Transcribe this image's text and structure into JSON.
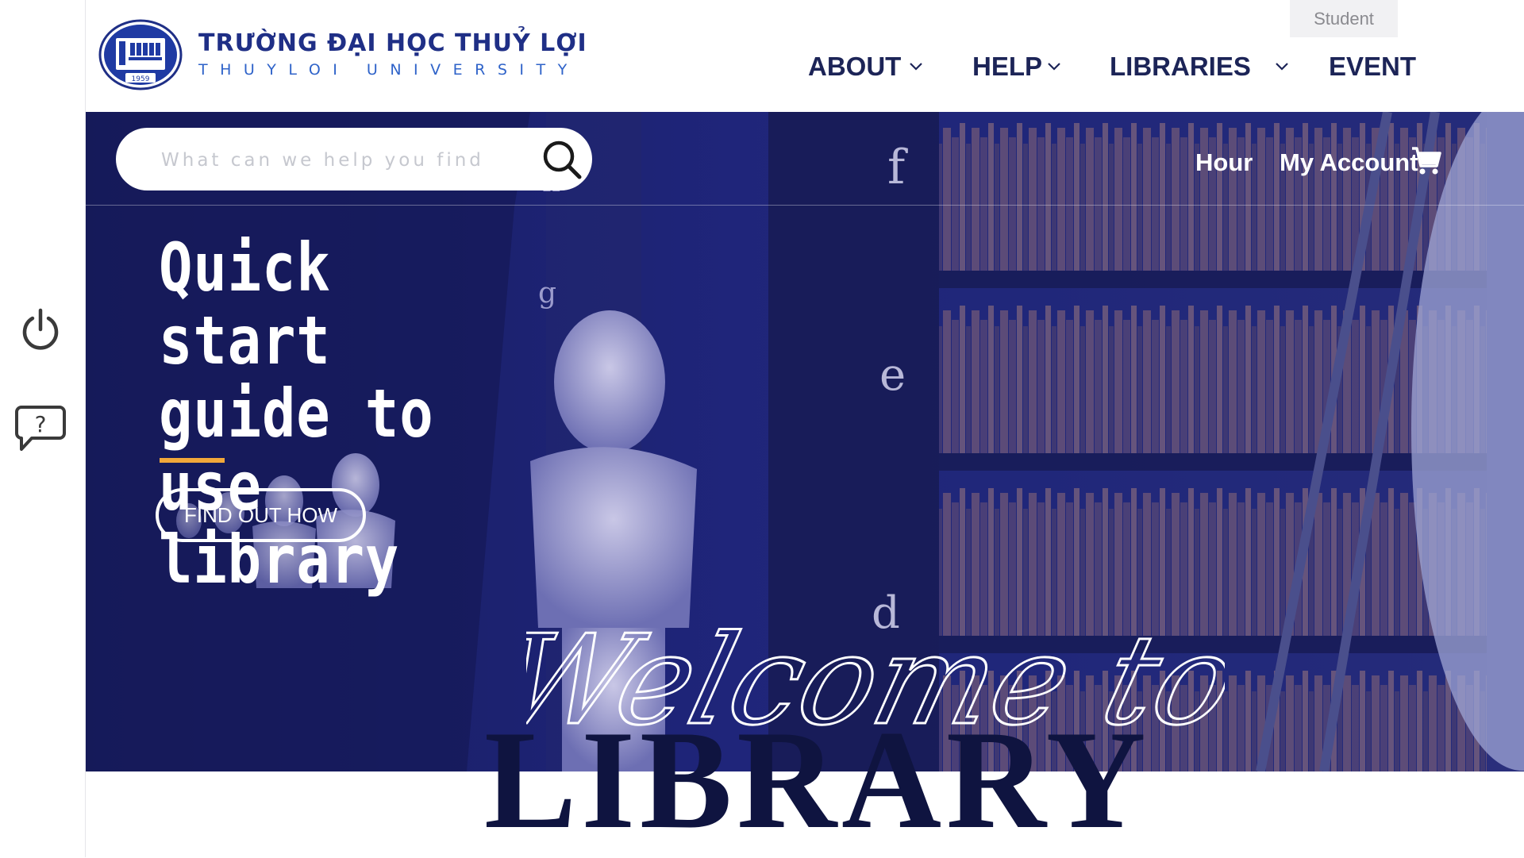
{
  "header": {
    "logo_title": "TRƯỜNG ĐẠI HỌC THUỶ LỢI",
    "logo_subtitle": "THUYLOI UNIVERSITY",
    "logo_seal": {
      "label": "ĐHTL",
      "year": "1959"
    },
    "student_tab": "Student",
    "nav": [
      {
        "label": "ABOUT",
        "has_dropdown": true
      },
      {
        "label": "HELP",
        "has_dropdown": true
      },
      {
        "label": "LIBRARIES",
        "has_dropdown": true
      },
      {
        "label": "EVENT",
        "has_dropdown": false
      }
    ]
  },
  "left_rail": {
    "icons": [
      "power-icon",
      "help-chat-icon"
    ]
  },
  "search": {
    "placeholder": "What can we help you find",
    "icon": "search-icon"
  },
  "hero_links": {
    "hour": "Hour",
    "account": "My Account",
    "cart_icon": "cart-icon"
  },
  "hero": {
    "heading_lines": [
      "Quick start",
      "guide to use",
      "library"
    ],
    "button": "FIND OUT HOW",
    "welcome": "Welcome to TLU",
    "library": "LIBRARY"
  },
  "colors": {
    "brand_navy": "#1c2457",
    "logo_blue": "#1f2f86",
    "logo_light_blue": "#2f63c9",
    "hero_overlay": "#1e2478",
    "accent_orange": "#f2a83a",
    "library_text": "#0f1440"
  }
}
